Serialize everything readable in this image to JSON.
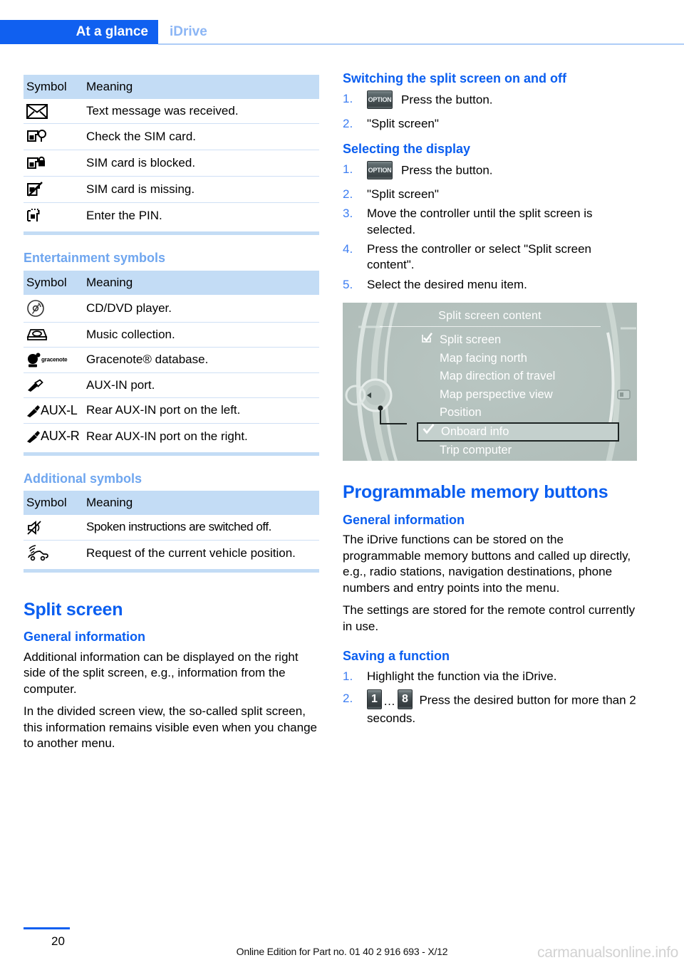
{
  "header": {
    "tab_label": "At a glance",
    "section_label": "iDrive"
  },
  "left_column": {
    "phone_table": {
      "col_symbol": "Symbol",
      "col_meaning": "Meaning",
      "rows": [
        {
          "icon": "envelope-icon",
          "meaning": "Text message was received."
        },
        {
          "icon": "sim-check-icon",
          "meaning": "Check the SIM card."
        },
        {
          "icon": "sim-locked-icon",
          "meaning": "SIM card is blocked."
        },
        {
          "icon": "sim-missing-icon",
          "meaning": "SIM card is missing."
        },
        {
          "icon": "sim-pin-icon",
          "meaning": "Enter the PIN."
        }
      ]
    },
    "entertainment_heading": "Entertainment symbols",
    "entertainment_table": {
      "col_symbol": "Symbol",
      "col_meaning": "Meaning",
      "rows": [
        {
          "icon": "cd-dvd-icon",
          "label": "",
          "meaning": "CD/DVD player."
        },
        {
          "icon": "music-collection-icon",
          "label": "",
          "meaning": "Music collection."
        },
        {
          "icon": "gracenote-icon",
          "label": "gracenote",
          "meaning": "Gracenote® database."
        },
        {
          "icon": "aux-plug-icon",
          "label": "",
          "meaning": "AUX-IN port."
        },
        {
          "icon": "aux-plug-icon",
          "label": "AUX-L",
          "meaning": "Rear AUX-IN port on the left."
        },
        {
          "icon": "aux-plug-icon",
          "label": "AUX-R",
          "meaning": "Rear AUX-IN port on the right."
        }
      ]
    },
    "additional_heading": "Additional symbols",
    "additional_table": {
      "col_symbol": "Symbol",
      "col_meaning": "Meaning",
      "rows": [
        {
          "icon": "speaker-muted-icon",
          "meaning": "Spoken instructions are switched off."
        },
        {
          "icon": "vehicle-position-icon",
          "meaning": "Request of the current vehicle position."
        }
      ]
    },
    "split_screen_heading": "Split screen",
    "general_info_heading": "General information",
    "general_info_p1": "Additional information can be displayed on the right side of the split screen, e.g., information from the computer.",
    "general_info_p2": "In the divided screen view, the so-called split screen, this information remains visible even when you change to another menu."
  },
  "right_column": {
    "switching_heading": "Switching the split screen on and off",
    "switching_steps": [
      {
        "button": "OPTION",
        "text": "Press the button."
      },
      {
        "button": "",
        "text": "\"Split screen\""
      }
    ],
    "selecting_heading": "Selecting the display",
    "selecting_steps": [
      {
        "button": "OPTION",
        "text": "Press the button."
      },
      {
        "button": "",
        "text": "\"Split screen\""
      },
      {
        "button": "",
        "text": "Move the controller until the split screen is selected."
      },
      {
        "button": "",
        "text": "Press the controller or select \"Split screen content\"."
      },
      {
        "button": "",
        "text": "Select the desired menu item."
      }
    ],
    "idrive_screenshot": {
      "title": "Split screen content",
      "items": [
        {
          "label": "Split screen",
          "mark": "checkbox-checked-icon",
          "selected": false
        },
        {
          "label": "Map facing north",
          "mark": "",
          "selected": false
        },
        {
          "label": "Map direction of travel",
          "mark": "",
          "selected": false
        },
        {
          "label": "Map perspective view",
          "mark": "",
          "selected": false
        },
        {
          "label": "Position",
          "mark": "",
          "selected": false
        },
        {
          "label": "Onboard info",
          "mark": "checkmark-icon",
          "selected": true
        },
        {
          "label": "Trip computer",
          "mark": "",
          "selected": false
        }
      ]
    },
    "memory_heading": "Programmable memory buttons",
    "memory_general_heading": "General information",
    "memory_p1": "The iDrive functions can be stored on the programmable memory buttons and called up directly, e.g., radio stations, navigation destinations, phone numbers and entry points into the menu.",
    "memory_p2": "The settings are stored for the remote control currently in use.",
    "saving_heading": "Saving a function",
    "saving_step1": "Highlight the function via the iDrive.",
    "saving_step2_btn_first": "1",
    "saving_step2_dots": "…",
    "saving_step2_btn_last": "8",
    "saving_step2_text": "Press the desired button for more than 2 seconds."
  },
  "footer": {
    "page_number": "20",
    "edition": "Online Edition for Part no. 01 40 2 916 693 - X/12",
    "watermark": "carmanualsonline.info"
  },
  "colors": {
    "brand_blue": "#0a5ef0",
    "tab_blue": "#1060f0",
    "light_blue": "#8cb6f5",
    "table_header": "#c3dcf5",
    "table_rule": "#cfe0f5",
    "idrive_bg": "#b6c3bf"
  }
}
